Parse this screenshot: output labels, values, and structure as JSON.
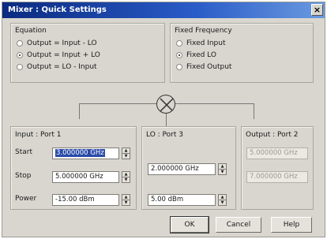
{
  "window": {
    "title": "Mixer : Quick Settings",
    "close_label": "×"
  },
  "equation": {
    "title": "Equation",
    "options": [
      {
        "label": "Output = Input - LO",
        "selected": false
      },
      {
        "label": "Output = Input + LO",
        "selected": true
      },
      {
        "label": "Output = LO - Input",
        "selected": false
      }
    ]
  },
  "fixed_frequency": {
    "title": "Fixed Frequency",
    "options": [
      {
        "label": "Fixed Input",
        "selected": false
      },
      {
        "label": "Fixed LO",
        "selected": true
      },
      {
        "label": "Fixed Output",
        "selected": false
      }
    ]
  },
  "input_port": {
    "title": "Input : Port 1",
    "start_label": "Start",
    "start_value": "3.000000 GHz",
    "stop_label": "Stop",
    "stop_value": "5.000000 GHz",
    "power_label": "Power",
    "power_value": "-15.00 dBm"
  },
  "lo_port": {
    "title": "LO : Port 3",
    "freq_value": "2.000000 GHz",
    "power_value": "5.00 dBm"
  },
  "output_port": {
    "title": "Output : Port 2",
    "start_value": "5.000000 GHz",
    "stop_value": "7.000000 GHz"
  },
  "buttons": {
    "ok": "OK",
    "cancel": "Cancel",
    "help": "Help"
  },
  "icons": {
    "mixer": "mixer-symbol-icon",
    "spin_up": "spin-up-icon",
    "spin_down": "spin-down-icon"
  }
}
